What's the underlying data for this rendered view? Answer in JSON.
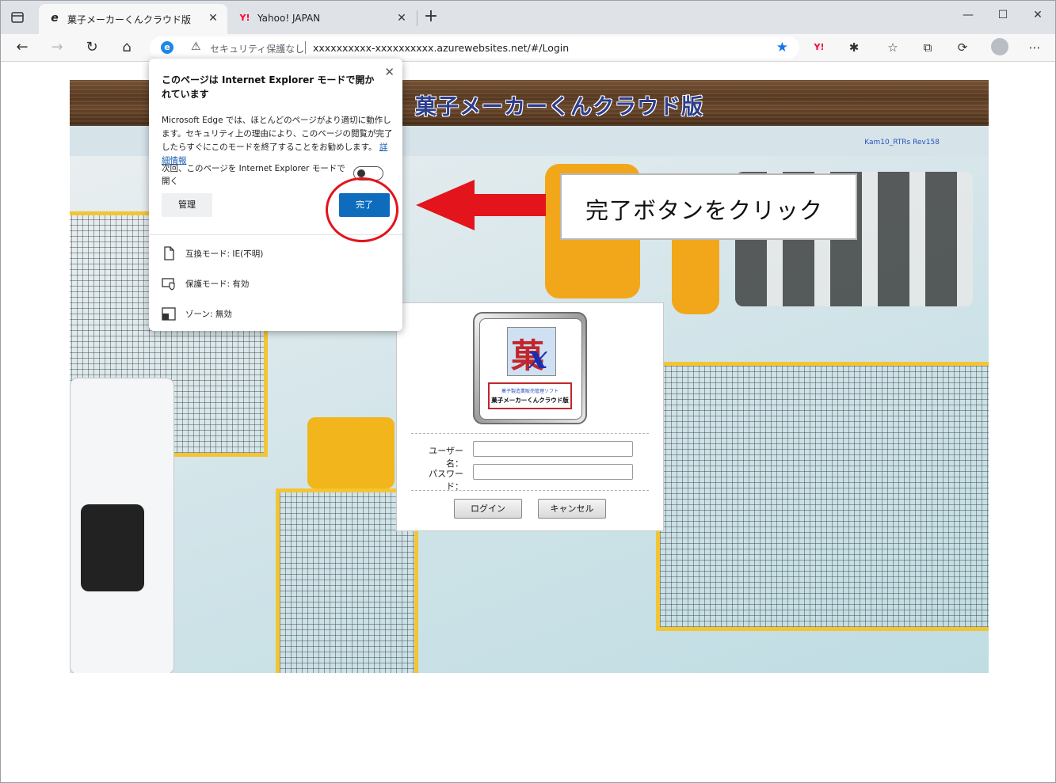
{
  "tabs": [
    {
      "title": "菓子メーカーくんクラウド版",
      "favicon": "ie-icon",
      "active": true
    },
    {
      "title": "Yahoo! JAPAN",
      "favicon": "yahoo-icon",
      "active": false
    }
  ],
  "addressbar": {
    "security_text": "セキュリティ保護なし",
    "url": "xxxxxxxxxx-xxxxxxxxxx.azurewebsites.net/#/Login"
  },
  "page": {
    "banner_title": "菓子メーカーくんクラウド版",
    "version": "Kam10_RTRs Rev158"
  },
  "login": {
    "logo_sub": "菓子製造業販売管理ソフト",
    "logo_name": "菓子メーカーくんクラウド版",
    "username_label": "ユーザー名：",
    "password_label": "パスワード：",
    "login_button": "ログイン",
    "cancel_button": "キャンセル"
  },
  "popup": {
    "title": "このページは Internet Explorer モードで開かれています",
    "body": "Microsoft Edge では、ほとんどのページがより適切に動作します。セキュリティ上の理由により、このページの閲覧が完了したらすぐにこのモードを終了することをお勧めします。",
    "link": "詳細情報",
    "toggle_text": "次回、このページを Internet Explorer モードで開く",
    "manage_button": "管理",
    "done_button": "完了",
    "rows": [
      {
        "icon": "page-icon",
        "text": "互換モード: IE(不明)"
      },
      {
        "icon": "shield-icon",
        "text": "保護モード: 有効"
      },
      {
        "icon": "zone-icon",
        "text": "ゾーン: 無効"
      }
    ]
  },
  "annotation": {
    "callout": "完了ボタンをクリック",
    "colors": {
      "arrow": "#e3141c",
      "circle": "#e3141c"
    }
  }
}
